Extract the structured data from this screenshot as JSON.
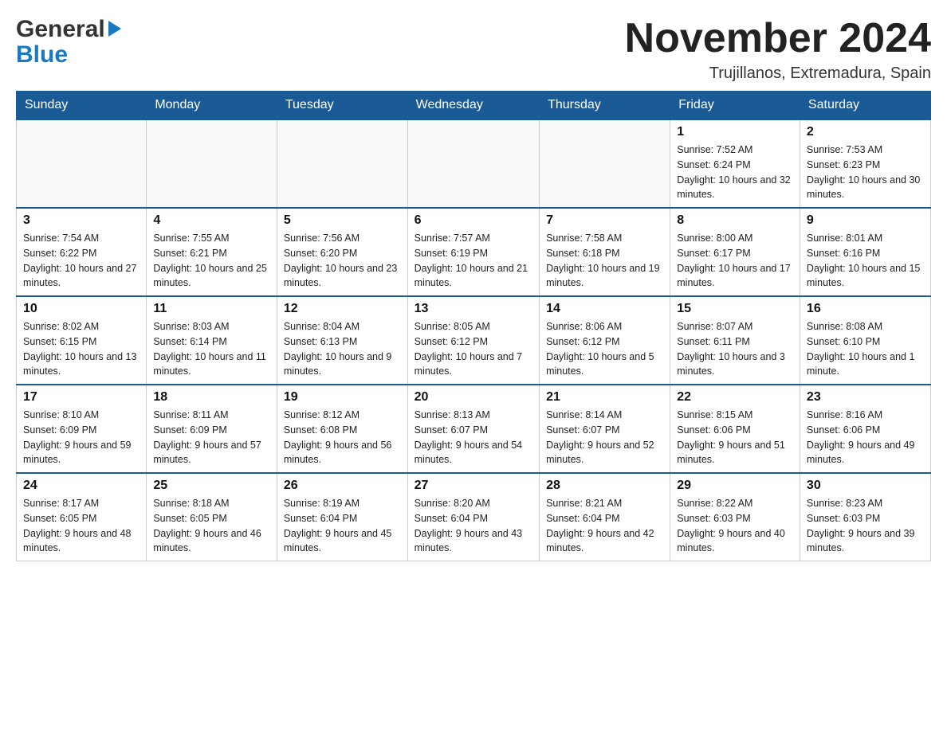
{
  "logo": {
    "general": "General",
    "blue": "Blue",
    "triangle_color": "#1a7abf"
  },
  "header": {
    "month_year": "November 2024",
    "location": "Trujillanos, Extremadura, Spain"
  },
  "weekdays": [
    "Sunday",
    "Monday",
    "Tuesday",
    "Wednesday",
    "Thursday",
    "Friday",
    "Saturday"
  ],
  "weeks": [
    [
      {
        "day": "",
        "info": ""
      },
      {
        "day": "",
        "info": ""
      },
      {
        "day": "",
        "info": ""
      },
      {
        "day": "",
        "info": ""
      },
      {
        "day": "",
        "info": ""
      },
      {
        "day": "1",
        "info": "Sunrise: 7:52 AM\nSunset: 6:24 PM\nDaylight: 10 hours and 32 minutes."
      },
      {
        "day": "2",
        "info": "Sunrise: 7:53 AM\nSunset: 6:23 PM\nDaylight: 10 hours and 30 minutes."
      }
    ],
    [
      {
        "day": "3",
        "info": "Sunrise: 7:54 AM\nSunset: 6:22 PM\nDaylight: 10 hours and 27 minutes."
      },
      {
        "day": "4",
        "info": "Sunrise: 7:55 AM\nSunset: 6:21 PM\nDaylight: 10 hours and 25 minutes."
      },
      {
        "day": "5",
        "info": "Sunrise: 7:56 AM\nSunset: 6:20 PM\nDaylight: 10 hours and 23 minutes."
      },
      {
        "day": "6",
        "info": "Sunrise: 7:57 AM\nSunset: 6:19 PM\nDaylight: 10 hours and 21 minutes."
      },
      {
        "day": "7",
        "info": "Sunrise: 7:58 AM\nSunset: 6:18 PM\nDaylight: 10 hours and 19 minutes."
      },
      {
        "day": "8",
        "info": "Sunrise: 8:00 AM\nSunset: 6:17 PM\nDaylight: 10 hours and 17 minutes."
      },
      {
        "day": "9",
        "info": "Sunrise: 8:01 AM\nSunset: 6:16 PM\nDaylight: 10 hours and 15 minutes."
      }
    ],
    [
      {
        "day": "10",
        "info": "Sunrise: 8:02 AM\nSunset: 6:15 PM\nDaylight: 10 hours and 13 minutes."
      },
      {
        "day": "11",
        "info": "Sunrise: 8:03 AM\nSunset: 6:14 PM\nDaylight: 10 hours and 11 minutes."
      },
      {
        "day": "12",
        "info": "Sunrise: 8:04 AM\nSunset: 6:13 PM\nDaylight: 10 hours and 9 minutes."
      },
      {
        "day": "13",
        "info": "Sunrise: 8:05 AM\nSunset: 6:12 PM\nDaylight: 10 hours and 7 minutes."
      },
      {
        "day": "14",
        "info": "Sunrise: 8:06 AM\nSunset: 6:12 PM\nDaylight: 10 hours and 5 minutes."
      },
      {
        "day": "15",
        "info": "Sunrise: 8:07 AM\nSunset: 6:11 PM\nDaylight: 10 hours and 3 minutes."
      },
      {
        "day": "16",
        "info": "Sunrise: 8:08 AM\nSunset: 6:10 PM\nDaylight: 10 hours and 1 minute."
      }
    ],
    [
      {
        "day": "17",
        "info": "Sunrise: 8:10 AM\nSunset: 6:09 PM\nDaylight: 9 hours and 59 minutes."
      },
      {
        "day": "18",
        "info": "Sunrise: 8:11 AM\nSunset: 6:09 PM\nDaylight: 9 hours and 57 minutes."
      },
      {
        "day": "19",
        "info": "Sunrise: 8:12 AM\nSunset: 6:08 PM\nDaylight: 9 hours and 56 minutes."
      },
      {
        "day": "20",
        "info": "Sunrise: 8:13 AM\nSunset: 6:07 PM\nDaylight: 9 hours and 54 minutes."
      },
      {
        "day": "21",
        "info": "Sunrise: 8:14 AM\nSunset: 6:07 PM\nDaylight: 9 hours and 52 minutes."
      },
      {
        "day": "22",
        "info": "Sunrise: 8:15 AM\nSunset: 6:06 PM\nDaylight: 9 hours and 51 minutes."
      },
      {
        "day": "23",
        "info": "Sunrise: 8:16 AM\nSunset: 6:06 PM\nDaylight: 9 hours and 49 minutes."
      }
    ],
    [
      {
        "day": "24",
        "info": "Sunrise: 8:17 AM\nSunset: 6:05 PM\nDaylight: 9 hours and 48 minutes."
      },
      {
        "day": "25",
        "info": "Sunrise: 8:18 AM\nSunset: 6:05 PM\nDaylight: 9 hours and 46 minutes."
      },
      {
        "day": "26",
        "info": "Sunrise: 8:19 AM\nSunset: 6:04 PM\nDaylight: 9 hours and 45 minutes."
      },
      {
        "day": "27",
        "info": "Sunrise: 8:20 AM\nSunset: 6:04 PM\nDaylight: 9 hours and 43 minutes."
      },
      {
        "day": "28",
        "info": "Sunrise: 8:21 AM\nSunset: 6:04 PM\nDaylight: 9 hours and 42 minutes."
      },
      {
        "day": "29",
        "info": "Sunrise: 8:22 AM\nSunset: 6:03 PM\nDaylight: 9 hours and 40 minutes."
      },
      {
        "day": "30",
        "info": "Sunrise: 8:23 AM\nSunset: 6:03 PM\nDaylight: 9 hours and 39 minutes."
      }
    ]
  ]
}
